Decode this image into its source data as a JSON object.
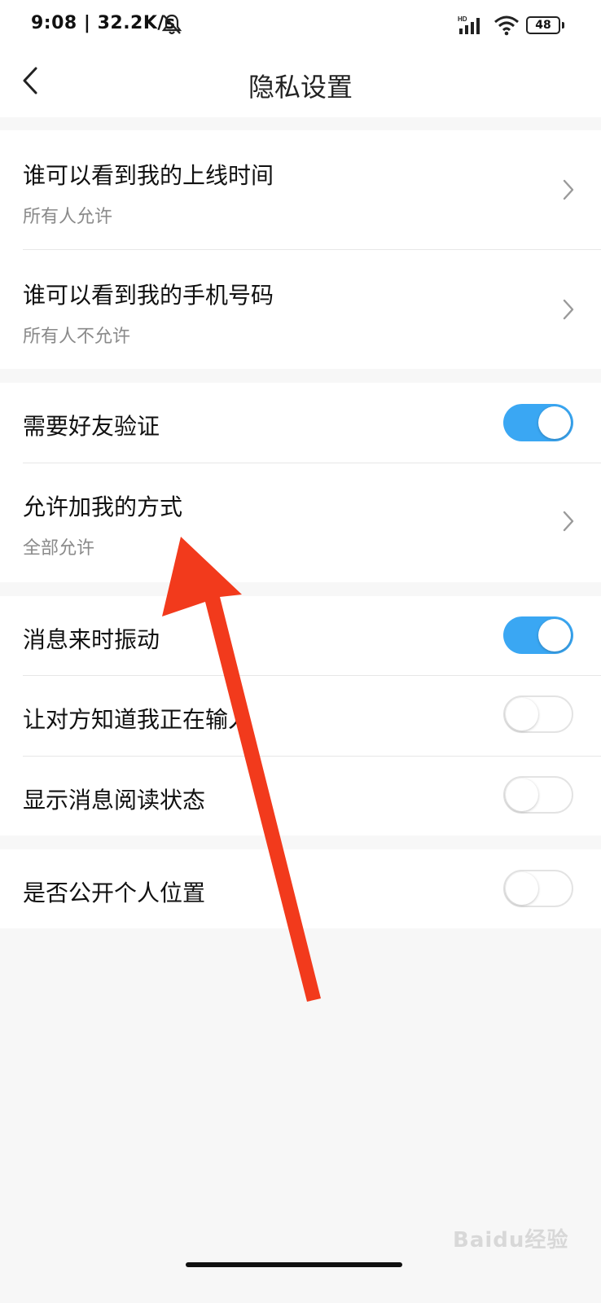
{
  "status_bar": {
    "time": "9:08 | 32.2K/s",
    "signal_label": "HD",
    "battery": "48",
    "icons": [
      "mute-bell-icon",
      "signal-icon",
      "wifi-icon",
      "battery-icon"
    ]
  },
  "header": {
    "title": "隐私设置",
    "back_icon": "chevron-left-icon"
  },
  "groups": [
    {
      "items": [
        {
          "title": "谁可以看到我的上线时间",
          "value": "所有人允许",
          "control": "chevron"
        },
        {
          "title": "谁可以看到我的手机号码",
          "value": "所有人不允许",
          "control": "chevron"
        }
      ]
    },
    {
      "items": [
        {
          "title": "需要好友验证",
          "control": "toggle",
          "on": true
        },
        {
          "title": "允许加我的方式",
          "value": "全部允许",
          "control": "chevron"
        }
      ]
    },
    {
      "items": [
        {
          "title": "消息来时振动",
          "control": "toggle",
          "on": true
        },
        {
          "title": "让对方知道我正在输入",
          "control": "toggle",
          "on": false
        },
        {
          "title": "显示消息阅读状态",
          "control": "toggle",
          "on": false
        }
      ]
    },
    {
      "items": [
        {
          "title": "是否公开个人位置",
          "control": "toggle",
          "on": false
        }
      ]
    }
  ],
  "overlay": {
    "annotation": "red-arrow",
    "color": "#f23a1c",
    "watermark": "Baidu经验"
  },
  "colors": {
    "toggle_on": "#3aa7f3",
    "background": "#f7f7f7"
  }
}
